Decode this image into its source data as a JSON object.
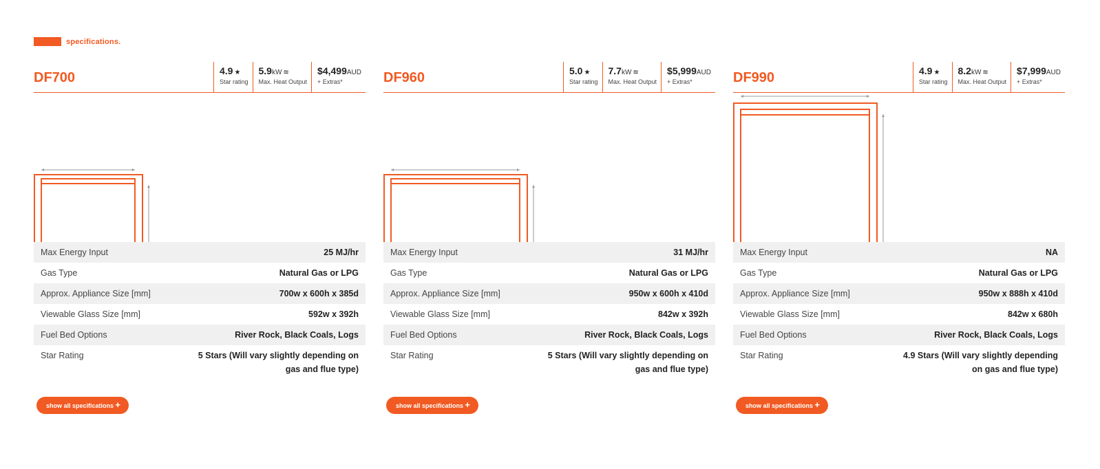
{
  "section": {
    "title": "specifications."
  },
  "products": [
    {
      "model": "DF700",
      "star": {
        "value": "4.9",
        "symbol": "★",
        "label": "Star rating"
      },
      "heat": {
        "value": "5.9",
        "unit": "kW",
        "symbol": "≋",
        "label": "Max. Heat Output"
      },
      "price": {
        "value": "$4,499",
        "unit": "AUD",
        "label": "+ Extras*"
      },
      "specs": [
        {
          "label": "Max Energy Input",
          "value": "25 MJ/hr"
        },
        {
          "label": "Gas Type",
          "value": "Natural Gas or LPG"
        },
        {
          "label": "Approx. Appliance Size [mm]",
          "value": "700w x 600h x 385d"
        },
        {
          "label": "Viewable Glass Size [mm]",
          "value": "592w x 392h"
        },
        {
          "label": "Fuel Bed Options",
          "value": "River Rock, Black Coals, Logs"
        },
        {
          "label": "Star Rating",
          "value": "5 Stars (Will vary slightly depending on gas and flue type)"
        }
      ],
      "button": {
        "label": "show all specifications",
        "icon": "+"
      }
    },
    {
      "model": "DF960",
      "star": {
        "value": "5.0",
        "symbol": "★",
        "label": "Star rating"
      },
      "heat": {
        "value": "7.7",
        "unit": "kW",
        "symbol": "≋",
        "label": "Max. Heat Output"
      },
      "price": {
        "value": "$5,999",
        "unit": "AUD",
        "label": "+ Extras*"
      },
      "specs": [
        {
          "label": "Max Energy Input",
          "value": "31 MJ/hr"
        },
        {
          "label": "Gas Type",
          "value": "Natural Gas or LPG"
        },
        {
          "label": "Approx. Appliance Size [mm]",
          "value": "950w x 600h x 410d"
        },
        {
          "label": "Viewable Glass Size [mm]",
          "value": "842w x 392h"
        },
        {
          "label": "Fuel Bed Options",
          "value": "River Rock, Black Coals, Logs"
        },
        {
          "label": "Star Rating",
          "value": "5 Stars (Will vary slightly depending on gas and flue type)"
        }
      ],
      "button": {
        "label": "show all specifications",
        "icon": "+"
      }
    },
    {
      "model": "DF990",
      "star": {
        "value": "4.9",
        "symbol": "★",
        "label": "Star rating"
      },
      "heat": {
        "value": "8.2",
        "unit": "kW",
        "symbol": "≋",
        "label": "Max. Heat Output"
      },
      "price": {
        "value": "$7,999",
        "unit": "AUD",
        "label": "+ Extras*"
      },
      "specs": [
        {
          "label": "Max Energy Input",
          "value": "NA"
        },
        {
          "label": "Gas Type",
          "value": "Natural Gas or LPG"
        },
        {
          "label": "Approx. Appliance Size [mm]",
          "value": "950w x 888h x 410d"
        },
        {
          "label": "Viewable Glass Size [mm]",
          "value": "842w x 680h"
        },
        {
          "label": "Fuel Bed Options",
          "value": "River Rock, Black Coals, Logs"
        },
        {
          "label": "Star Rating",
          "value": "4.9 Stars (Will vary slightly depending on gas and flue type)"
        }
      ],
      "button": {
        "label": "show all specifications",
        "icon": "+"
      }
    }
  ],
  "colors": {
    "accent": "#f15a22",
    "row_alt": "#f0f0f0",
    "dimension_line": "#9a9a9a"
  }
}
